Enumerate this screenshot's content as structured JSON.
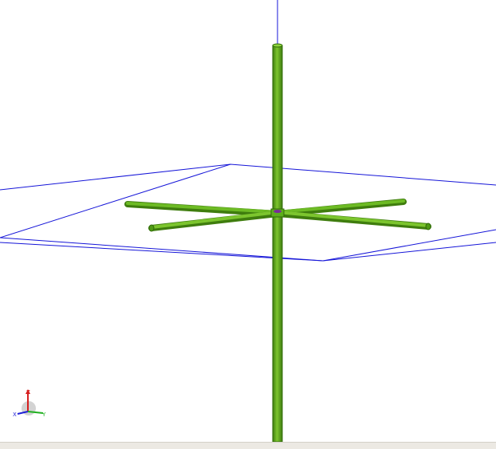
{
  "scene": {
    "colors": {
      "background": "#ffffff",
      "wire": "#1515d8",
      "element_fill": "#5cae1b",
      "element_shade": "#3f7d0e",
      "element_highlight": "#9bdc4a",
      "feed_port": "#7a2a9a"
    },
    "objects": {
      "vertical_radiator": "vertical-radiator",
      "ground_radials": "ground-radials",
      "wire_box": "wire-box",
      "feed_point": "feed-point"
    }
  },
  "axis_triad": {
    "z_label": "Z",
    "x_label": "X",
    "y_label": "Y",
    "z_color": "#d62020",
    "y_color": "#20b020",
    "x_color": "#2020d6"
  }
}
